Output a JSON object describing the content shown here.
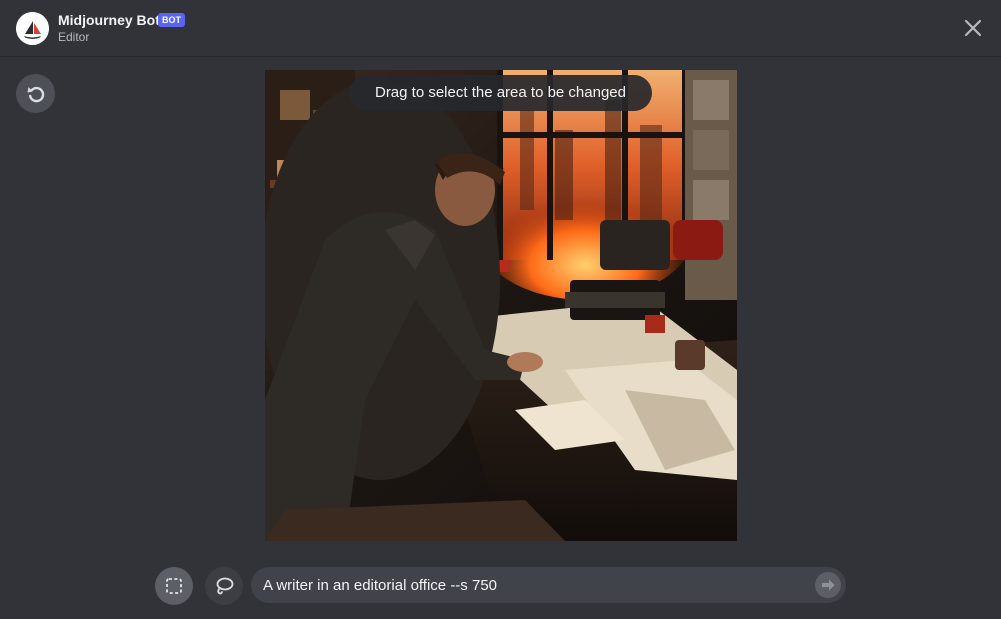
{
  "header": {
    "bot_name": "Midjourney Bot",
    "badge": "BOT",
    "subtitle": "Editor",
    "avatar_icon": "midjourney-sailboat-icon",
    "close_icon": "close-icon"
  },
  "toolbar": {
    "reset_icon": "reset-icon",
    "rect_select_icon": "rectangle-select-icon",
    "lasso_icon": "lasso-select-icon",
    "send_icon": "send-arrow-icon"
  },
  "canvas": {
    "tooltip": "Drag to select the area to be changed"
  },
  "prompt": {
    "value": "A writer in an editorial office --s 750"
  },
  "colors": {
    "background": "#313338",
    "badge": "#5865f2",
    "input": "#41434a"
  }
}
